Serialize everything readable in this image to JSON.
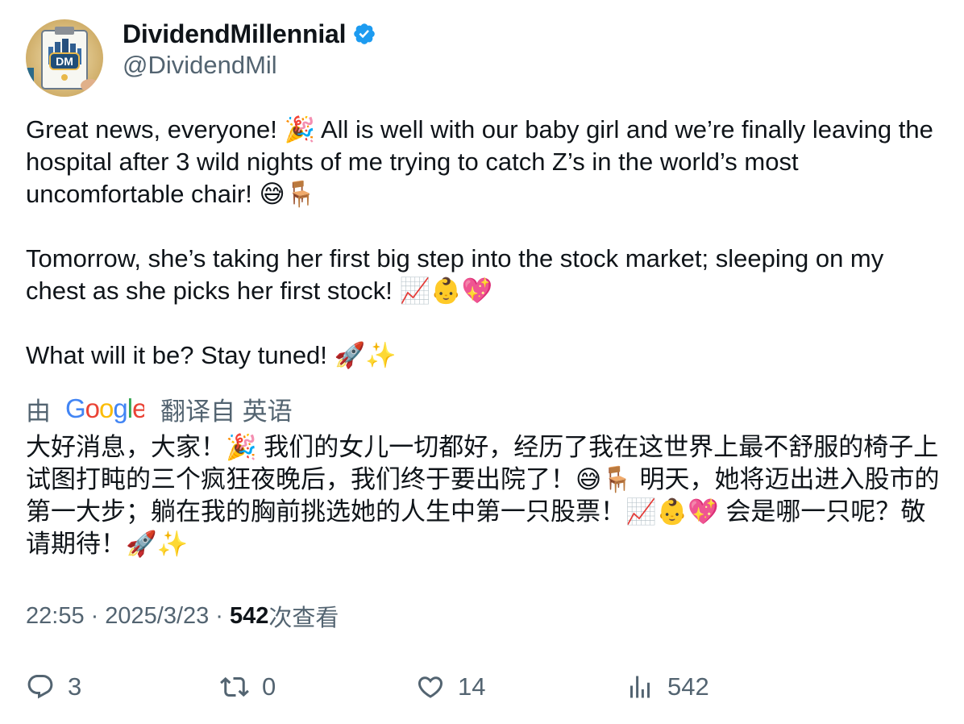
{
  "author": {
    "display_name": "DividendMillennial",
    "handle": "@DividendMil",
    "avatar_initials": "DM",
    "verified_icon": "verified-badge-icon",
    "verified_color": "#1d9bf0"
  },
  "tweet": {
    "paragraphs": [
      "Great news, everyone! 🎉 All is well with our baby girl and we’re finally leaving the hospital after 3 wild nights of me trying to catch Z’s in the world’s most uncomfortable chair! 😅🪑",
      "Tomorrow, she’s taking her first big step into the stock market; sleeping on my chest as she picks her first stock! 📈👶💖",
      "What will it be? Stay tuned! 🚀✨"
    ]
  },
  "translation": {
    "prefix": "由",
    "provider_logo": "Google",
    "suffix": "翻译自 英语",
    "text": "大好消息，大家！🎉 我们的女儿一切都好，经历了我在这世界上最不舒服的椅子上试图打盹的三个疯狂夜晚后，我们终于要出院了！😅🪑 明天，她将迈出进入股市的第一大步；躺在我的胸前挑选她的人生中第一只股票！📈👶💖 会是哪一只呢？敬请期待！🚀✨"
  },
  "meta": {
    "time": "22:55",
    "separator": "·",
    "date": "2025/3/23",
    "views_count": "542",
    "views_label": "次查看"
  },
  "actions": {
    "reply": {
      "icon": "reply-icon",
      "count": "3"
    },
    "retweet": {
      "icon": "retweet-icon",
      "count": "0"
    },
    "like": {
      "icon": "heart-icon",
      "count": "14"
    },
    "views": {
      "icon": "analytics-icon",
      "count": "542"
    }
  },
  "colors": {
    "text_primary": "#0f1419",
    "text_secondary": "#536471",
    "accent": "#1d9bf0"
  }
}
